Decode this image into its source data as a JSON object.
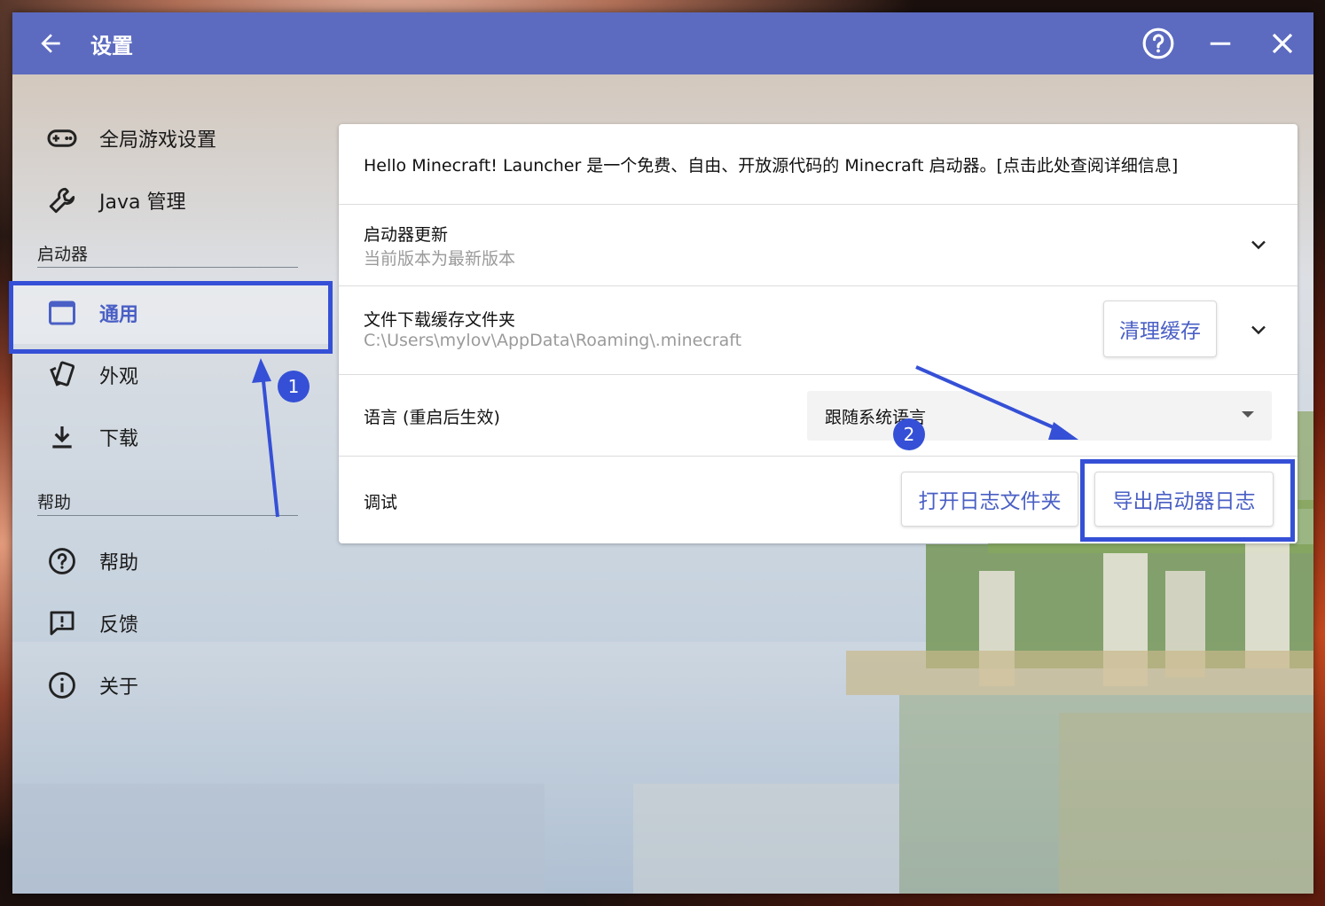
{
  "window": {
    "title": "设置",
    "controls": [
      "help-icon",
      "minimize-icon",
      "close-icon"
    ]
  },
  "sidebar": {
    "top_items": [
      {
        "label": "全局游戏设置",
        "icon": "gamepad-icon"
      },
      {
        "label": "Java 管理",
        "icon": "wrench-icon"
      }
    ],
    "section_launcher": "启动器",
    "launcher_items": [
      {
        "label": "通用",
        "icon": "window-icon",
        "active": true
      },
      {
        "label": "外观",
        "icon": "cards-icon"
      },
      {
        "label": "下载",
        "icon": "download-icon"
      }
    ],
    "section_help": "帮助",
    "help_items": [
      {
        "label": "帮助",
        "icon": "question-icon"
      },
      {
        "label": "反馈",
        "icon": "feedback-icon"
      },
      {
        "label": "关于",
        "icon": "info-icon"
      }
    ]
  },
  "panel": {
    "intro": "Hello Minecraft! Launcher 是一个免费、自由、开放源代码的 Minecraft 启动器。[点击此处查阅详细信息]",
    "update": {
      "title": "启动器更新",
      "subtitle": "当前版本为最新版本"
    },
    "cache": {
      "title": "文件下载缓存文件夹",
      "path": "C:\\Users\\mylov\\AppData\\Roaming\\.minecraft",
      "clear_button": "清理缓存"
    },
    "language": {
      "label": "语言 (重启后生效)",
      "value": "跟随系统语言"
    },
    "debug": {
      "label": "调试",
      "open_logs_button": "打开日志文件夹",
      "export_logs_button": "导出启动器日志"
    }
  },
  "annotations": {
    "badge1": "1",
    "badge2": "2",
    "color": "#3550d6"
  },
  "colors": {
    "titlebar": "#5c6bc0",
    "accent": "#4a5fc5"
  }
}
